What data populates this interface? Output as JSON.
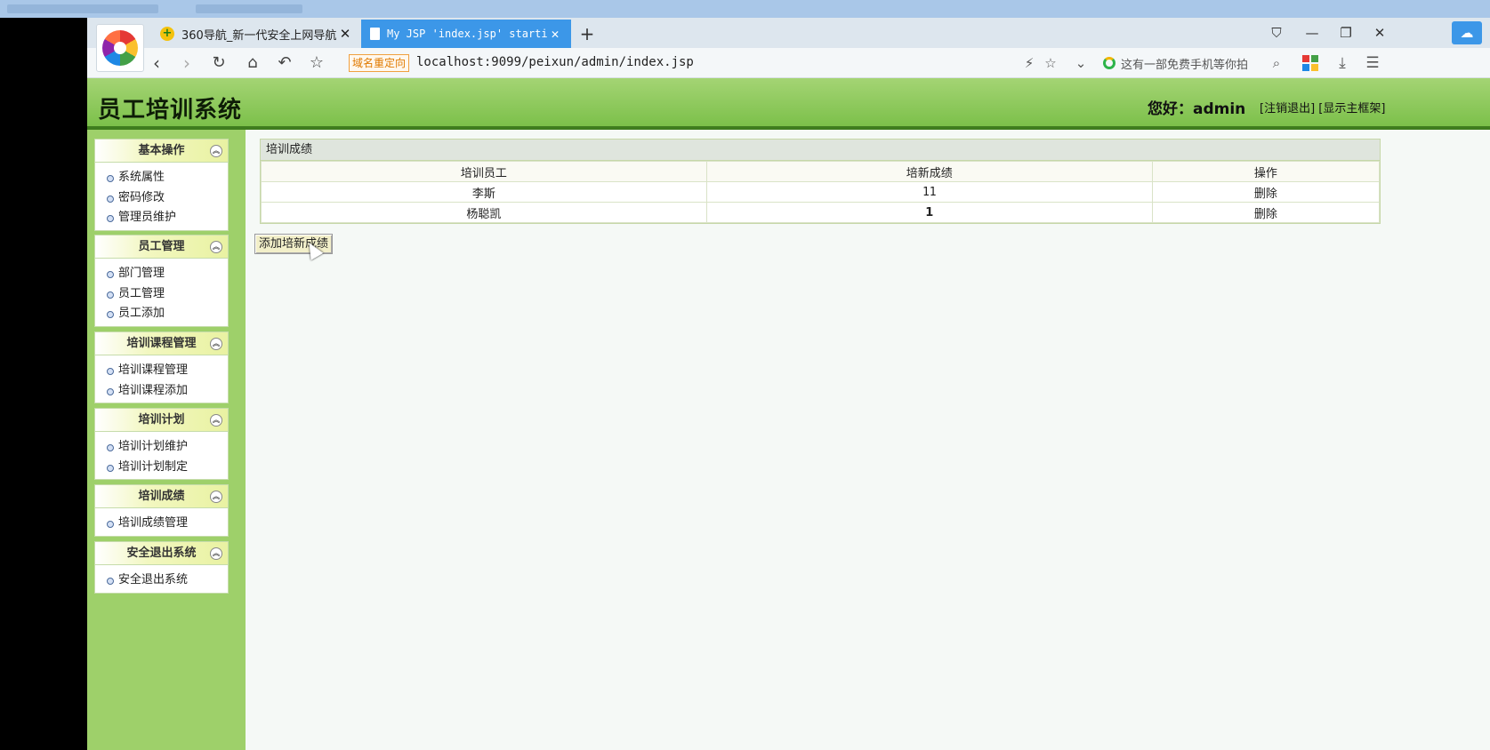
{
  "browser": {
    "tabs": [
      {
        "label": "360导航_新一代安全上网导航",
        "active": false
      },
      {
        "label": "My JSP 'index.jsp' starting",
        "active": true
      }
    ],
    "redirect_badge": "域名重定向",
    "url": "localhost:9099/peixun/admin/index.jsp",
    "search_placeholder": "这有一部免费手机等你拍"
  },
  "header": {
    "title": "员工培训系统",
    "greeting": "您好：admin",
    "logout_link": "[注销退出]",
    "show_frame_link": "[显示主框架]"
  },
  "sidebar": {
    "groups": [
      {
        "title": "基本操作",
        "items": [
          "系统属性",
          "密码修改",
          "管理员维护"
        ]
      },
      {
        "title": "员工管理",
        "items": [
          "部门管理",
          "员工管理",
          "员工添加"
        ]
      },
      {
        "title": "培训课程管理",
        "items": [
          "培训课程管理",
          "培训课程添加"
        ]
      },
      {
        "title": "培训计划",
        "items": [
          "培训计划维护",
          "培训计划制定"
        ]
      },
      {
        "title": "培训成绩",
        "items": [
          "培训成绩管理"
        ]
      },
      {
        "title": "安全退出系统",
        "items": [
          "安全退出系统"
        ]
      }
    ]
  },
  "main": {
    "panel_title": "培训成绩",
    "columns": [
      "培训员工",
      "培新成绩",
      "操作"
    ],
    "rows": [
      {
        "employee": "李斯",
        "score": "11",
        "action": "删除"
      },
      {
        "employee": "杨聪凯",
        "score": "1",
        "action": "删除"
      }
    ],
    "add_button": "添加培新成绩"
  },
  "colors": {
    "header_green": "#7cc04a",
    "sidebar_green": "#9ed06a",
    "active_tab_blue": "#3c97e8"
  }
}
